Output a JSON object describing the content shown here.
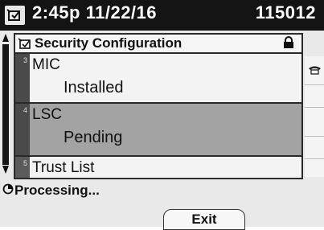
{
  "header": {
    "icon": "phone-menu-icon",
    "datetime": "2:45p 11/22/16",
    "extension": "115012"
  },
  "panel": {
    "title": "Security Configuration",
    "title_icon": "settings-check-icon",
    "lock_icon": "lock-icon",
    "items": [
      {
        "number": "3",
        "label": "MIC",
        "status": "Installed",
        "selected": false
      },
      {
        "number": "4",
        "label": "LSC",
        "status": "Pending",
        "selected": true
      },
      {
        "number": "5",
        "label": "Trust List",
        "status": "",
        "selected": false
      }
    ]
  },
  "linekeys": {
    "icon": "handset-icon"
  },
  "status": {
    "icon": "spinner-icon",
    "text": "Processing..."
  },
  "softkeys": {
    "exit_label": "Exit"
  },
  "colors": {
    "header_bg": "#141414",
    "selected_row": "#a3a3a3",
    "screen_bg": "#e9e9e9"
  }
}
